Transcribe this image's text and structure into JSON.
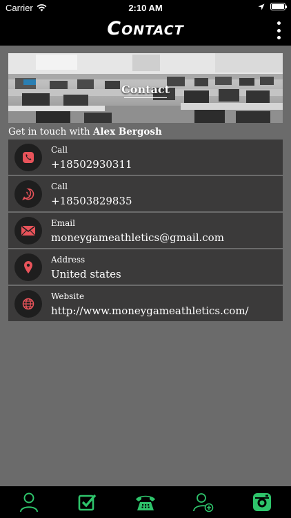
{
  "status_bar": {
    "carrier": "Carrier",
    "time": "2:10 AM"
  },
  "header": {
    "title": "Contact"
  },
  "banner": {
    "title": "Contact"
  },
  "intro": {
    "prefix": "Get in touch with",
    "name": "Alex Bergosh"
  },
  "contacts": [
    {
      "label": "Call",
      "value": "+18502930311",
      "icon": "phone-icon"
    },
    {
      "label": "Call",
      "value": "+18503829835",
      "icon": "whatsapp-icon"
    },
    {
      "label": "Email",
      "value": "moneygameathletics@gmail.com",
      "icon": "mail-icon"
    },
    {
      "label": "Address",
      "value": "United states",
      "icon": "location-pin-icon"
    },
    {
      "label": "Website",
      "value": "http://www.moneygameathletics.com/",
      "icon": "globe-icon"
    }
  ],
  "tabs": [
    {
      "icon": "person-icon"
    },
    {
      "icon": "checkbox-icon"
    },
    {
      "icon": "telephone-icon"
    },
    {
      "icon": "add-person-icon"
    },
    {
      "icon": "camera-icon"
    }
  ],
  "colors": {
    "accent_red": "#e8535a",
    "tab_green": "#2ec46b",
    "row_bg": "#3b3a3a",
    "page_bg": "#6b6b6b"
  }
}
